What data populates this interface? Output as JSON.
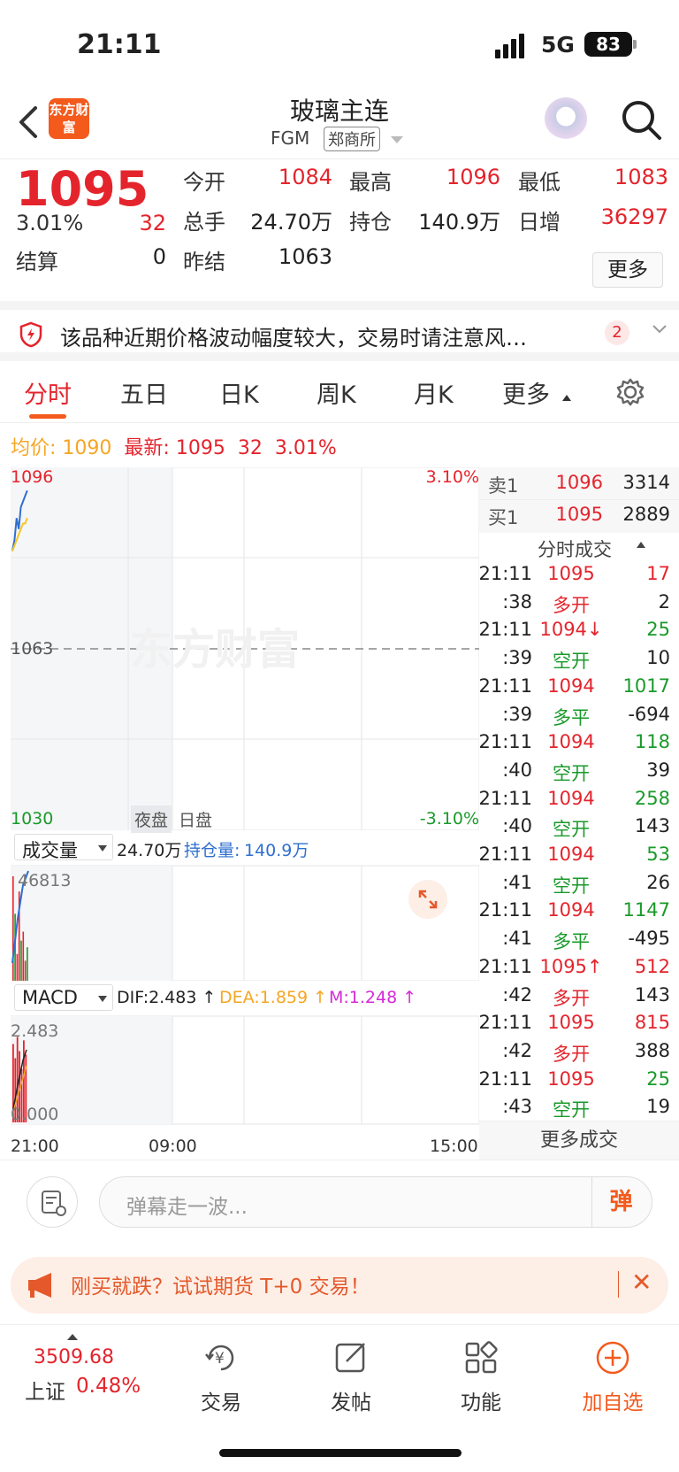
{
  "status": {
    "time": "21:11",
    "network": "5G",
    "battery": "83"
  },
  "header": {
    "title": "玻璃主连",
    "code": "FGM",
    "exchange": "郑商所",
    "logo_text": "东方财富"
  },
  "quote": {
    "price": "1095",
    "pct": "3.01%",
    "change": "32",
    "open_label": "今开",
    "open": "1084",
    "high_label": "最高",
    "high": "1096",
    "low_label": "最低",
    "low": "1083",
    "vol_label": "总手",
    "vol": "24.70万",
    "oi_label": "持仓",
    "oi": "140.9万",
    "inc_label": "日增",
    "inc": "36297",
    "settle_label": "结算",
    "settle": "0",
    "prev_label": "昨结",
    "prev": "1063",
    "more": "更多"
  },
  "notice": {
    "text": "该品种近期价格波动幅度较大，交易时请注意风…",
    "count": "2"
  },
  "tabs": [
    {
      "label": "分时"
    },
    {
      "label": "五日"
    },
    {
      "label": "日K"
    },
    {
      "label": "周K"
    },
    {
      "label": "月K"
    },
    {
      "label": "更多"
    }
  ],
  "avgline": {
    "avg_label": "均价:",
    "avg": "1090",
    "last_label": "最新:",
    "last": "1095",
    "chg": "32",
    "pct": "3.01%"
  },
  "chart_data": {
    "type": "line",
    "title": "",
    "y_top": "1096",
    "y_mid": "1063",
    "y_bottom": "1030",
    "pct_top": "3.10%",
    "pct_bottom": "-3.10%",
    "ylim": [
      1030,
      1096
    ],
    "prev_settle": 1063,
    "session_labels": [
      "夜盘",
      "日盘"
    ],
    "x_labels": [
      "21:00",
      "09:00",
      "15:00"
    ],
    "series": [
      {
        "name": "",
        "color": "#2f6fcf",
        "values": [
          1084,
          1086,
          1090,
          1088,
          1092,
          1093,
          1094,
          1095
        ]
      },
      {
        "name": "",
        "color": "#f5c623",
        "values": [
          1084,
          1085,
          1086,
          1087,
          1088,
          1089,
          1089,
          1090
        ]
      }
    ],
    "volume": {
      "max_label": "46813",
      "bars": [
        46813,
        30000,
        12000,
        40000,
        18000,
        22000,
        9000,
        15000
      ]
    },
    "macd": {
      "max_label": "2.483",
      "min_label": "0.000",
      "bars": [
        2.2,
        1.8,
        2.4,
        2.0,
        1.5,
        2.3,
        1.9
      ]
    }
  },
  "vol_panel": {
    "label": "成交量",
    "vol": "24.70万",
    "oi_label": "持仓量:",
    "oi": "140.9万"
  },
  "macd_panel": {
    "label": "MACD",
    "dif": "DIF:2.483 ↑",
    "dea": "DEA:1.859 ↑",
    "m": "M:1.248 ↑"
  },
  "book": {
    "sell": {
      "label": "卖1",
      "price": "1096",
      "qty": "3314"
    },
    "buy": {
      "label": "买1",
      "price": "1095",
      "qty": "2889"
    },
    "ticks_title": "分时成交",
    "more": "更多成交",
    "ticks": [
      {
        "a": "21:11",
        "b": "1095",
        "c": "17",
        "bc": "red",
        "cc": "red"
      },
      {
        "a": ":38",
        "b": "多开",
        "c": "2",
        "bc": "red",
        "cc": "dark"
      },
      {
        "a": "21:11",
        "b": "1094↓",
        "c": "25",
        "bc": "red",
        "cc": "green"
      },
      {
        "a": ":39",
        "b": "空开",
        "c": "10",
        "bc": "green",
        "cc": "dark"
      },
      {
        "a": "21:11",
        "b": "1094",
        "c": "1017",
        "bc": "red",
        "cc": "green"
      },
      {
        "a": ":39",
        "b": "多平",
        "c": "-694",
        "bc": "green",
        "cc": "dark"
      },
      {
        "a": "21:11",
        "b": "1094",
        "c": "118",
        "bc": "red",
        "cc": "green"
      },
      {
        "a": ":40",
        "b": "空开",
        "c": "39",
        "bc": "green",
        "cc": "dark"
      },
      {
        "a": "21:11",
        "b": "1094",
        "c": "258",
        "bc": "red",
        "cc": "green"
      },
      {
        "a": ":40",
        "b": "空开",
        "c": "143",
        "bc": "green",
        "cc": "dark"
      },
      {
        "a": "21:11",
        "b": "1094",
        "c": "53",
        "bc": "red",
        "cc": "green"
      },
      {
        "a": ":41",
        "b": "空开",
        "c": "26",
        "bc": "green",
        "cc": "dark"
      },
      {
        "a": "21:11",
        "b": "1094",
        "c": "1147",
        "bc": "red",
        "cc": "green"
      },
      {
        "a": ":41",
        "b": "多平",
        "c": "-495",
        "bc": "green",
        "cc": "dark"
      },
      {
        "a": "21:11",
        "b": "1095↑",
        "c": "512",
        "bc": "red",
        "cc": "red"
      },
      {
        "a": ":42",
        "b": "多开",
        "c": "143",
        "bc": "red",
        "cc": "dark"
      },
      {
        "a": "21:11",
        "b": "1095",
        "c": "815",
        "bc": "red",
        "cc": "red"
      },
      {
        "a": ":42",
        "b": "多开",
        "c": "388",
        "bc": "red",
        "cc": "dark"
      },
      {
        "a": "21:11",
        "b": "1095",
        "c": "25",
        "bc": "red",
        "cc": "green"
      },
      {
        "a": ":43",
        "b": "空开",
        "c": "19",
        "bc": "green",
        "cc": "dark"
      }
    ]
  },
  "comment": {
    "placeholder": "弹幕走一波...",
    "send": "弹"
  },
  "promo": {
    "text": "刚买就跌？试试期货 T+0 交易！",
    "close": "✕"
  },
  "bottom": {
    "index_value": "3509.68",
    "index_name": "上证",
    "index_pct": "0.48%",
    "nav": [
      {
        "label": "交易"
      },
      {
        "label": "发帖"
      },
      {
        "label": "功能"
      },
      {
        "label": "加自选"
      }
    ]
  }
}
